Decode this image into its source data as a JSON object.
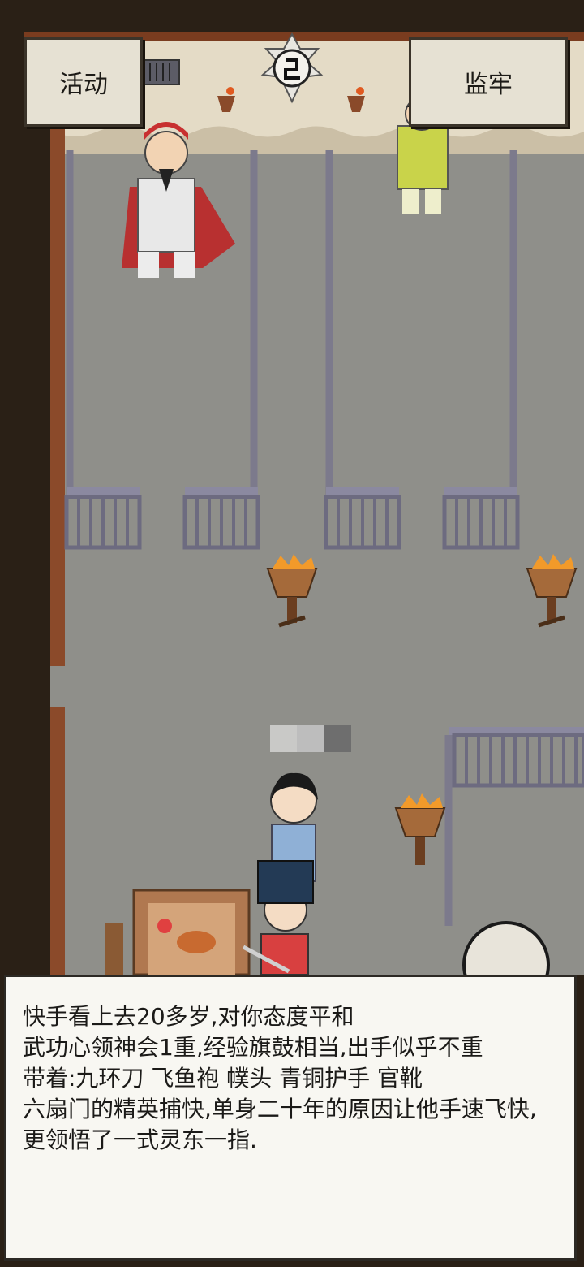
{
  "top_buttons": {
    "activity_label": "活动",
    "prison_label": "监牢"
  },
  "dialog": {
    "lines": [
      "快手看上去20多岁,对你态度平和",
      "武功心领神会1重,经验旗鼓相当,出手似乎不重",
      "带着:九环刀 飞鱼袍 幞头 青铜护手 官靴",
      "六扇门的精英捕快,单身二十年的原因让他手速飞快,",
      "更领悟了一式灵东一指."
    ]
  },
  "icons": {
    "compass": "yin-yang-compass-icon",
    "run": "running-man-icon"
  },
  "colors": {
    "floor": "#8f8f8a",
    "wall": "#e6dcc8",
    "pillar": "#8b4a2a",
    "bars": "#7c7a8c",
    "panel": "#f8f7f2"
  }
}
